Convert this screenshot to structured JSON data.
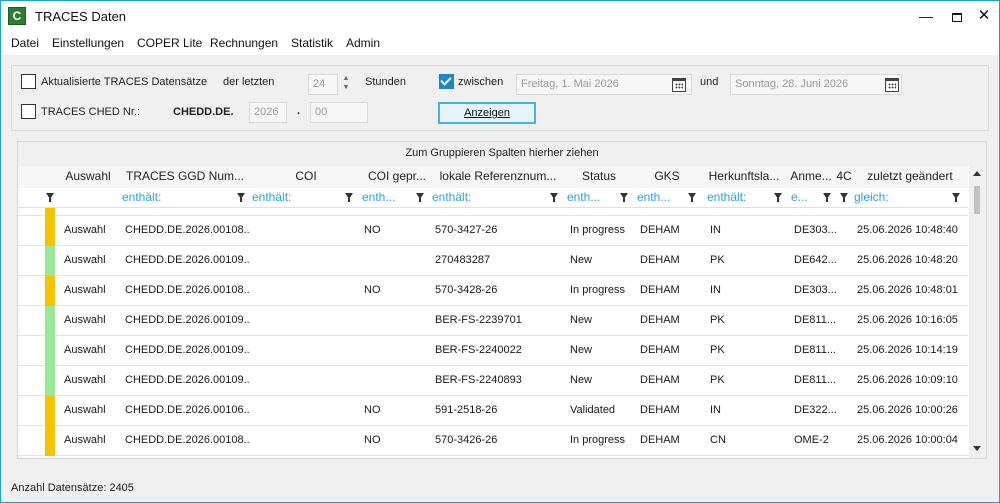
{
  "window": {
    "title": "TRACES Daten",
    "app_icon_letter": "C"
  },
  "menu": [
    "Datei",
    "Einstellungen",
    "COPER Lite",
    "Rechnungen",
    "Statistik",
    "Admin"
  ],
  "filters": {
    "updated_label": "Aktualisierte TRACES Datensätze",
    "last_label": "der letzten",
    "hours_value": "24",
    "hours_unit": "Stunden",
    "between_label": "zwischen",
    "between_checked": true,
    "date_from": "Freitag, 1. Mai 2026",
    "and_label": "und",
    "date_to": "Sonntag, 28. Juni 2026",
    "ched_label": "TRACES CHED Nr.:",
    "ched_prefix": "CHEDD.DE.",
    "year_placeholder": "2026",
    "dot": ".",
    "number_placeholder": "00",
    "show_button": "Anzeigen"
  },
  "grid": {
    "group_hint": "Zum Gruppieren Spalten hierher ziehen",
    "columns": [
      {
        "label": "Auswahl",
        "filter": ""
      },
      {
        "label": "TRACES GGD Num...",
        "filter": "enthält:"
      },
      {
        "label": "COI",
        "filter": "enthält:"
      },
      {
        "label": "COI gepr...",
        "filter": "enth..."
      },
      {
        "label": "lokale Referenznum...",
        "filter": "enthält:"
      },
      {
        "label": "Status",
        "filter": "enth..."
      },
      {
        "label": "GKS",
        "filter": "enth..."
      },
      {
        "label": "Herkunftsla...",
        "filter": "enthält:"
      },
      {
        "label": "Anme...",
        "filter": "e..."
      },
      {
        "label": "4C",
        "filter": ""
      },
      {
        "label": "zuletzt geändert",
        "filter": "gleich:"
      }
    ],
    "rows": [
      {
        "color": "#f5c400",
        "auswahl": "Auswahl",
        "ggd": "CHEDD.DE.2026.00108...",
        "coi": "",
        "coi_gepr": "NO",
        "ref": "570-3427-26",
        "status": "In progress",
        "gks": "DEHAM",
        "herkunft": "IN",
        "anme": "DE303...",
        "changed": "25.06.2026 10:48:40"
      },
      {
        "color": "#9be89b",
        "auswahl": "Auswahl",
        "ggd": "CHEDD.DE.2026.00109...",
        "coi": "",
        "coi_gepr": "",
        "ref": "270483287",
        "status": "New",
        "gks": "DEHAM",
        "herkunft": "PK",
        "anme": "DE642...",
        "changed": "25.06.2026 10:48:20"
      },
      {
        "color": "#f5c400",
        "auswahl": "Auswahl",
        "ggd": "CHEDD.DE.2026.00108...",
        "coi": "",
        "coi_gepr": "NO",
        "ref": "570-3428-26",
        "status": "In progress",
        "gks": "DEHAM",
        "herkunft": "IN",
        "anme": "DE303...",
        "changed": "25.06.2026 10:48:01"
      },
      {
        "color": "#9be89b",
        "auswahl": "Auswahl",
        "ggd": "CHEDD.DE.2026.00109...",
        "coi": "",
        "coi_gepr": "",
        "ref": "BER-FS-2239701",
        "status": "New",
        "gks": "DEHAM",
        "herkunft": "PK",
        "anme": "DE811...",
        "changed": "25.06.2026 10:16:05"
      },
      {
        "color": "#9be89b",
        "auswahl": "Auswahl",
        "ggd": "CHEDD.DE.2026.00109...",
        "coi": "",
        "coi_gepr": "",
        "ref": "BER-FS-2240022",
        "status": "New",
        "gks": "DEHAM",
        "herkunft": "PK",
        "anme": "DE811...",
        "changed": "25.06.2026 10:14:19"
      },
      {
        "color": "#9be89b",
        "auswahl": "Auswahl",
        "ggd": "CHEDD.DE.2026.00109...",
        "coi": "",
        "coi_gepr": "",
        "ref": "BER-FS-2240893",
        "status": "New",
        "gks": "DEHAM",
        "herkunft": "PK",
        "anme": "DE811...",
        "changed": "25.06.2026 10:09:10"
      },
      {
        "color": "#f5c400",
        "auswahl": "Auswahl",
        "ggd": "CHEDD.DE.2026.00106...",
        "coi": "",
        "coi_gepr": "NO",
        "ref": "591-2518-26",
        "status": "Validated",
        "gks": "DEHAM",
        "herkunft": "IN",
        "anme": "DE322...",
        "changed": "25.06.2026 10:00:26"
      },
      {
        "color": "#f5c400",
        "auswahl": "Auswahl",
        "ggd": "CHEDD.DE.2026.00108...",
        "coi": "",
        "coi_gepr": "NO",
        "ref": "570-3426-26",
        "status": "In progress",
        "gks": "DEHAM",
        "herkunft": "CN",
        "anme": "OME-2",
        "changed": "25.06.2026 10:00:04"
      }
    ]
  },
  "status": {
    "records_label": "Anzahl Datensätze: 2405"
  }
}
